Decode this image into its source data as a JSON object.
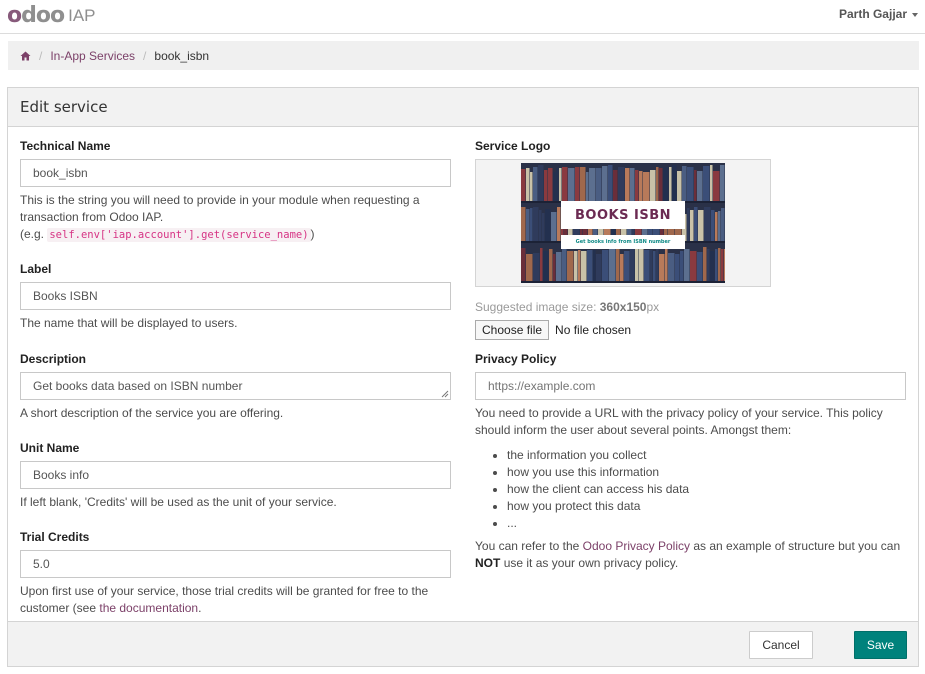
{
  "app": {
    "logo_brand": "odoo",
    "logo_product": "IAP",
    "user_name": "Parth Gajjar",
    "brand_color": "#875a7b",
    "link_color": "#7c4169",
    "primary_color": "#00827c"
  },
  "breadcrumb": {
    "home_icon": "home-icon",
    "separator": "/",
    "items": [
      {
        "label": "In-App Services"
      },
      {
        "label": "book_isbn"
      }
    ]
  },
  "card": {
    "title": "Edit service"
  },
  "fields": {
    "technical_name": {
      "label": "Technical Name",
      "value": "book_isbn",
      "help_1": "This is the string you will need to provide in your module when requesting a transaction from Odoo IAP.",
      "help_2_prefix": "(e.g.",
      "help_2_code": "self.env['iap.account'].get(service_name)",
      "help_2_suffix": ")"
    },
    "label": {
      "label": "Label",
      "value": "Books ISBN",
      "help": "The name that will be displayed to users."
    },
    "description": {
      "label": "Description",
      "value": "Get books data based on ISBN number",
      "help": "A short description of the service you are offering."
    },
    "unit_name": {
      "label": "Unit Name",
      "value": "Books info",
      "help": "If left blank, 'Credits' will be used as the unit of your service."
    },
    "trial_credits": {
      "label": "Trial Credits",
      "value": "5.0",
      "help_prefix": "Upon first use of your service, those trial credits will be granted for free to the customer (see ",
      "help_link": "the documentation",
      "help_suffix": "."
    },
    "service_logo": {
      "label": "Service Logo",
      "image_title": "BOOKS ISBN",
      "image_subtitle": "Get books info from ISBN number",
      "hint_prefix": "Suggested image size:",
      "hint_size": "360x150",
      "hint_unit": "px",
      "file_button": "Choose file",
      "file_status": "No file chosen"
    },
    "privacy_policy": {
      "label": "Privacy Policy",
      "placeholder": "https://example.com",
      "help_1": "You need to provide a URL with the privacy policy of your service. This policy should inform the user about several points. Amongst them:",
      "points": [
        "the information you collect",
        "how you use this information",
        "how the client can access his data",
        "how you protect this data",
        "..."
      ],
      "help_2_prefix": "You can refer to the",
      "help_2_link": "Odoo Privacy Policy",
      "help_2_middle": "as an example of structure but you can",
      "help_2_bold": "NOT",
      "help_2_suffix": "use it as your own privacy policy."
    }
  },
  "footer": {
    "cancel_label": "Cancel",
    "save_label": "Save"
  }
}
